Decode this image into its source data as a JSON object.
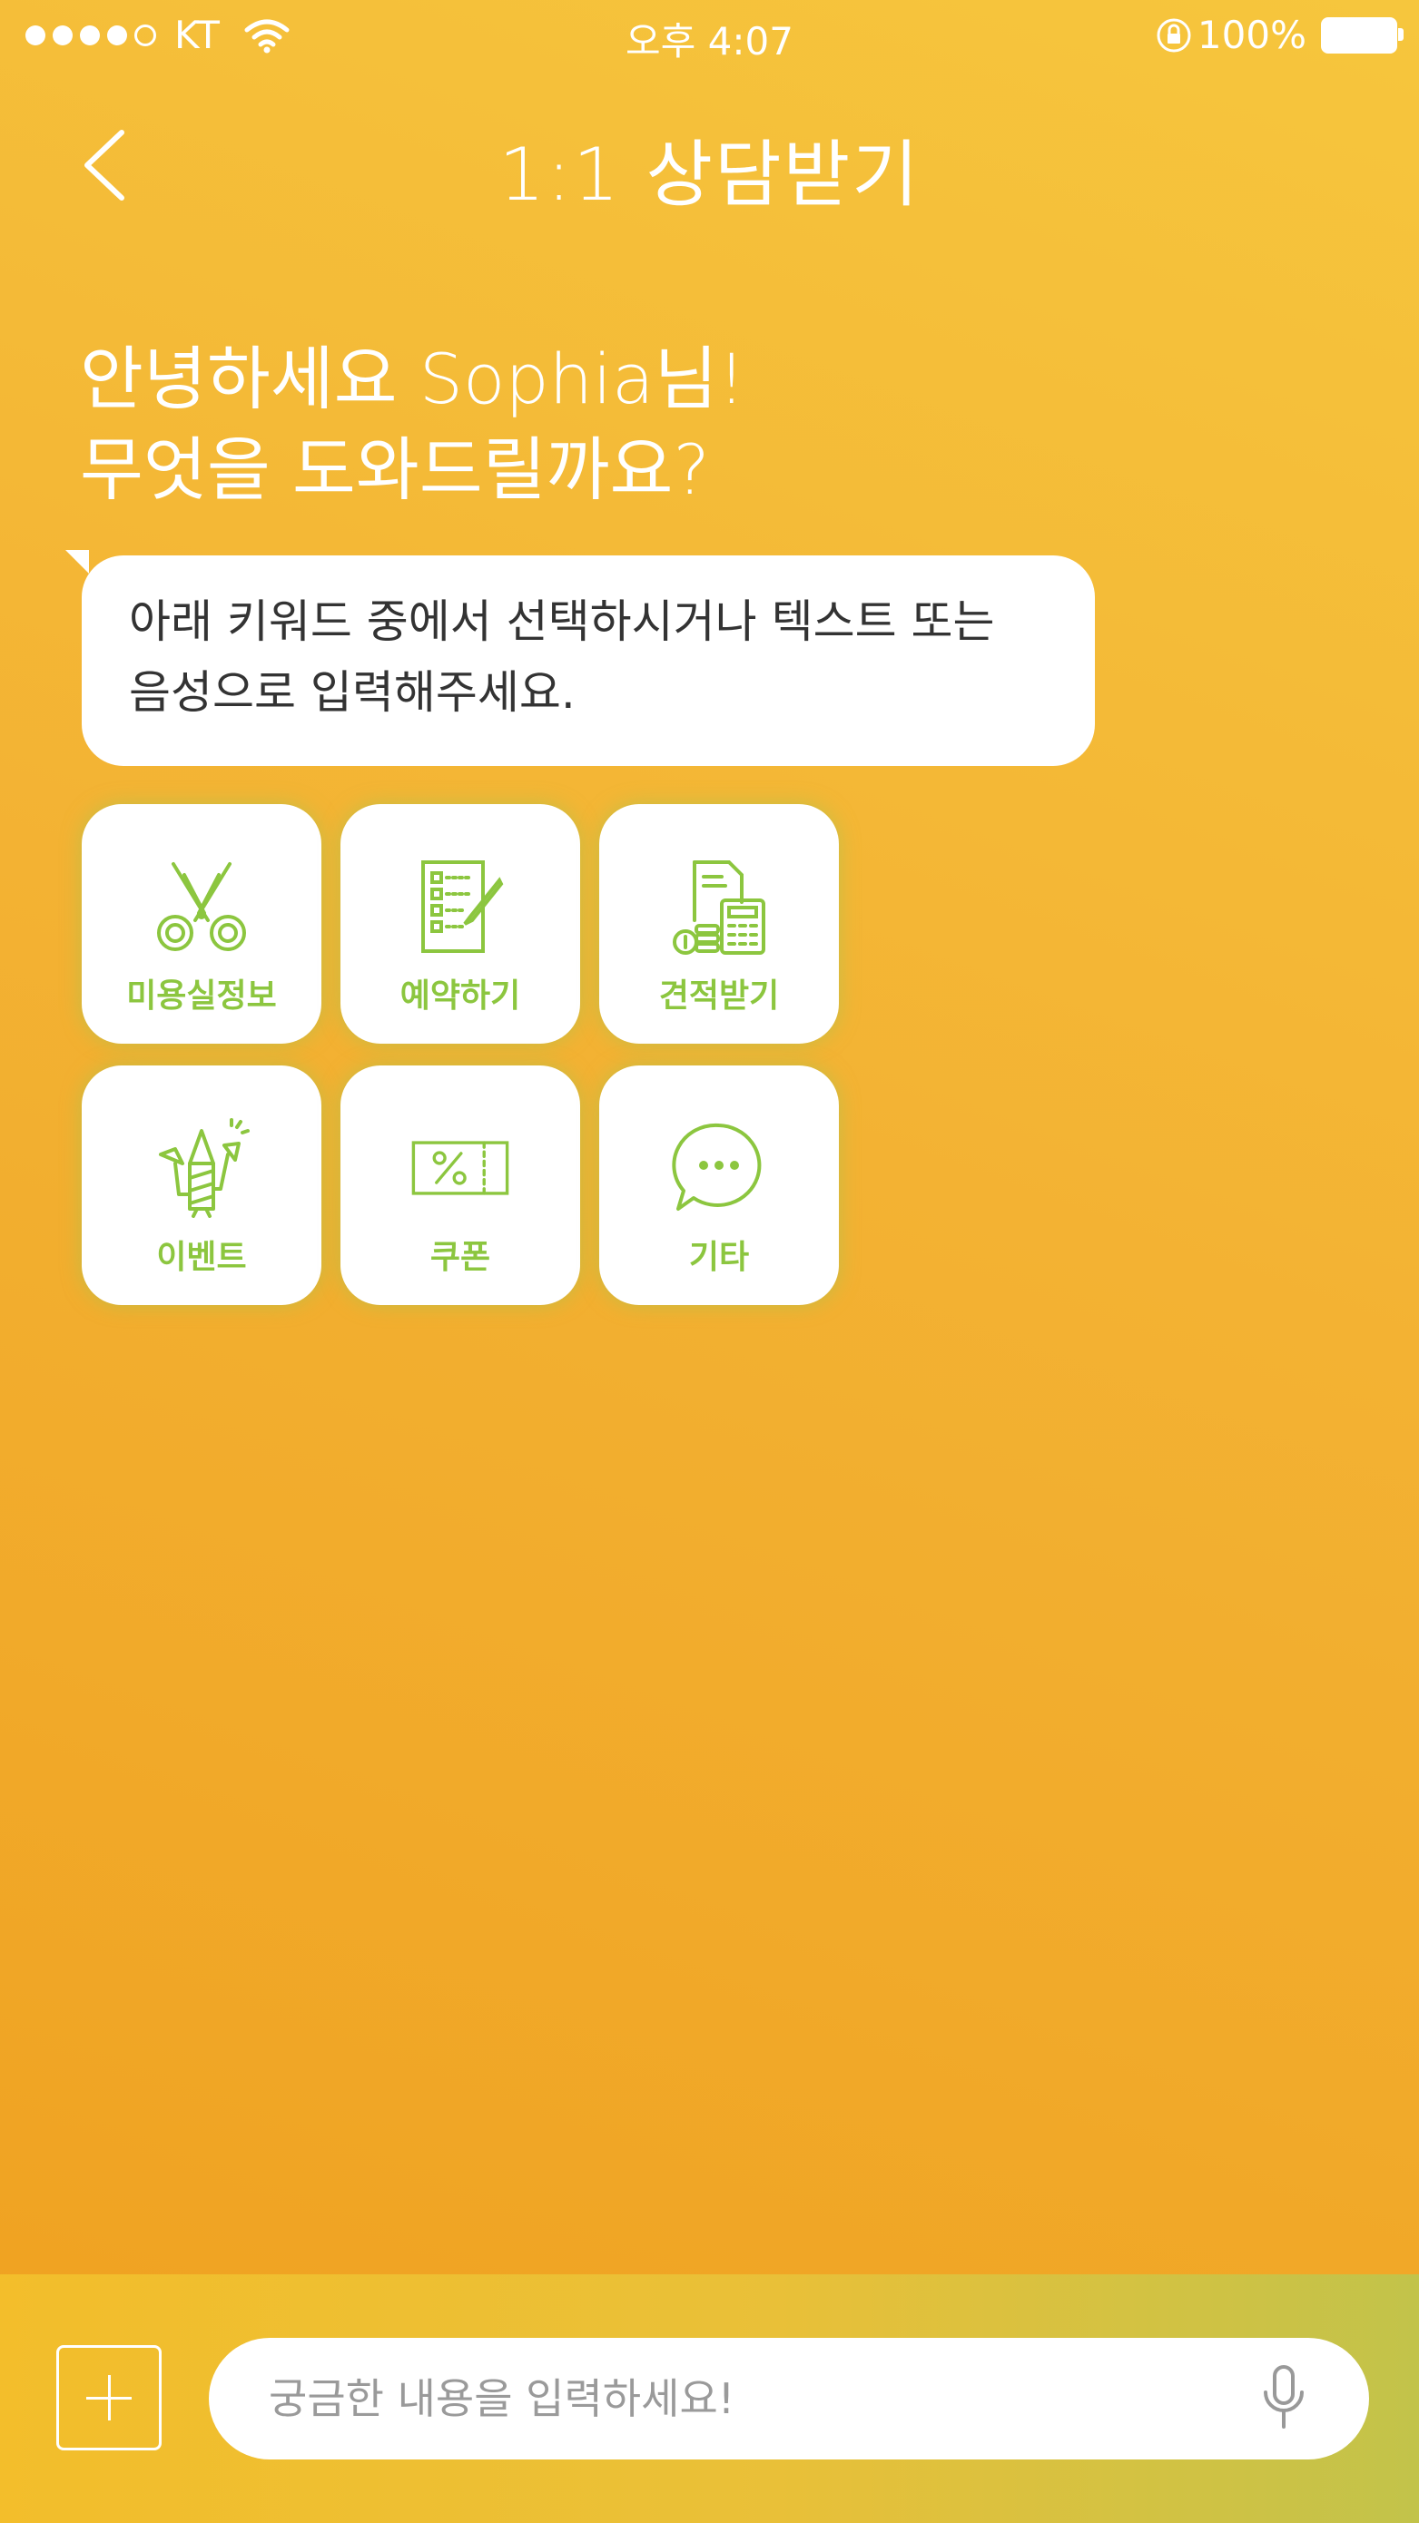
{
  "status_bar": {
    "carrier": "KT",
    "time": "오후 4:07",
    "battery": "100%",
    "signal_bars_filled": 4,
    "signal_bars_total": 5
  },
  "header": {
    "title": "1:1 상담받기",
    "back_icon": "chevron-left-icon"
  },
  "greeting": {
    "line1": "안녕하세요 Sophia님!",
    "line2": "무엇을 도와드릴까요?"
  },
  "message": {
    "line1": "아래 키워드 중에서 선택하시거나 텍스트 또는",
    "line2": "음성으로 입력해주세요."
  },
  "keywords": [
    {
      "label": "미용실정보",
      "icon": "scissors-icon"
    },
    {
      "label": "예약하기",
      "icon": "checklist-icon"
    },
    {
      "label": "견적받기",
      "icon": "calculator-icon"
    },
    {
      "label": "이벤트",
      "icon": "fireworks-icon"
    },
    {
      "label": "쿠폰",
      "icon": "coupon-icon"
    },
    {
      "label": "기타",
      "icon": "chat-bubble-icon"
    }
  ],
  "input_bar": {
    "placeholder": "궁금한 내용을 입력하세요!",
    "add_icon": "plus-icon",
    "mic_icon": "microphone-icon"
  },
  "colors": {
    "background": "#f3b233",
    "accent_green": "#8cc63f",
    "text_white": "#ffffff"
  }
}
